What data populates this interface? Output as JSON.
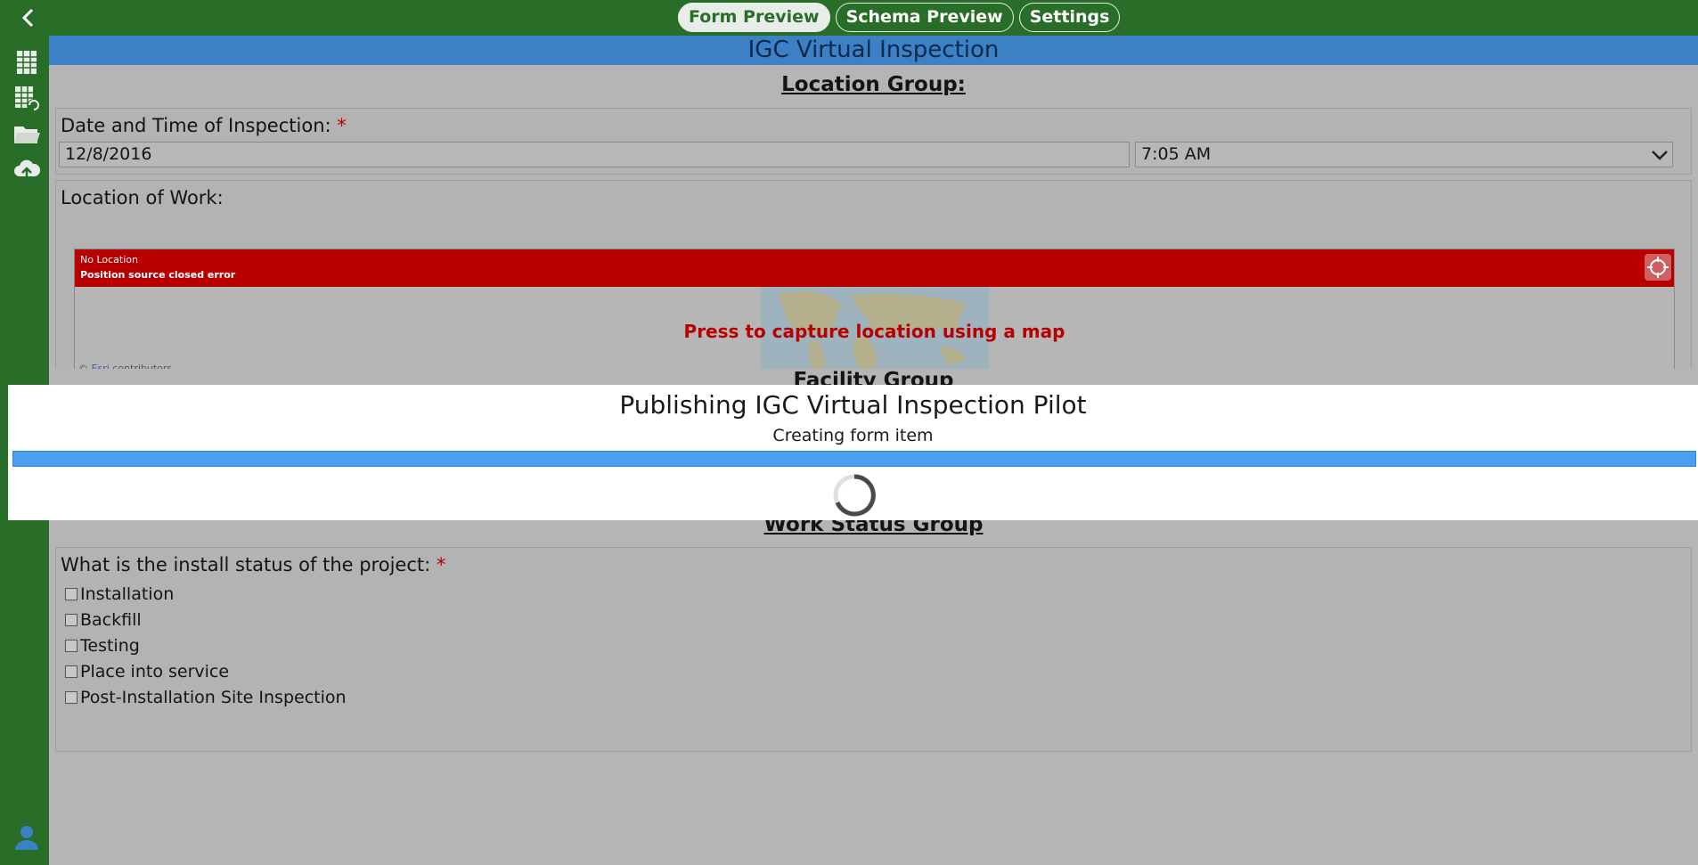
{
  "topbar": {
    "tabs": [
      {
        "label": "Form Preview",
        "active": true
      },
      {
        "label": "Schema Preview",
        "active": false
      },
      {
        "label": "Settings",
        "active": false
      }
    ]
  },
  "sidebar": {
    "icons": [
      "table-icon",
      "table-refresh-icon",
      "folder-icon",
      "cloud-upload-icon",
      "user-icon"
    ]
  },
  "form": {
    "title": "IGC Virtual Inspection",
    "location_group": {
      "title": "Location Group:",
      "datetime_label": "Date and Time of Inspection:",
      "required_mark": "*",
      "date_value": "12/8/2016",
      "time_value": "7:05 AM",
      "location_label": "Location of Work:",
      "map": {
        "banner_line1": "No Location",
        "banner_line2": "Position source closed error",
        "prompt": "Press to capture location using a map",
        "attribution_prefix": "©",
        "attribution_link": "Esri",
        "attribution_suffix": "contributors"
      }
    },
    "facility_group_title": "Facility Group",
    "work_status_group": {
      "title": "Work Status Group",
      "question": "What is the install status of the project:",
      "required_mark": "*",
      "options": [
        "Installation",
        "Backfill",
        "Testing",
        "Place into service",
        "Post-Installation Site Inspection"
      ]
    }
  },
  "modal": {
    "title": "Publishing IGC Virtual Inspection Pilot",
    "subtitle": "Creating form item",
    "progress": 1.0
  },
  "colors": {
    "header_green": "#286e28",
    "title_blue": "#3c80c6",
    "error_red": "#b80000",
    "progress_blue": "#4aa0ec"
  }
}
